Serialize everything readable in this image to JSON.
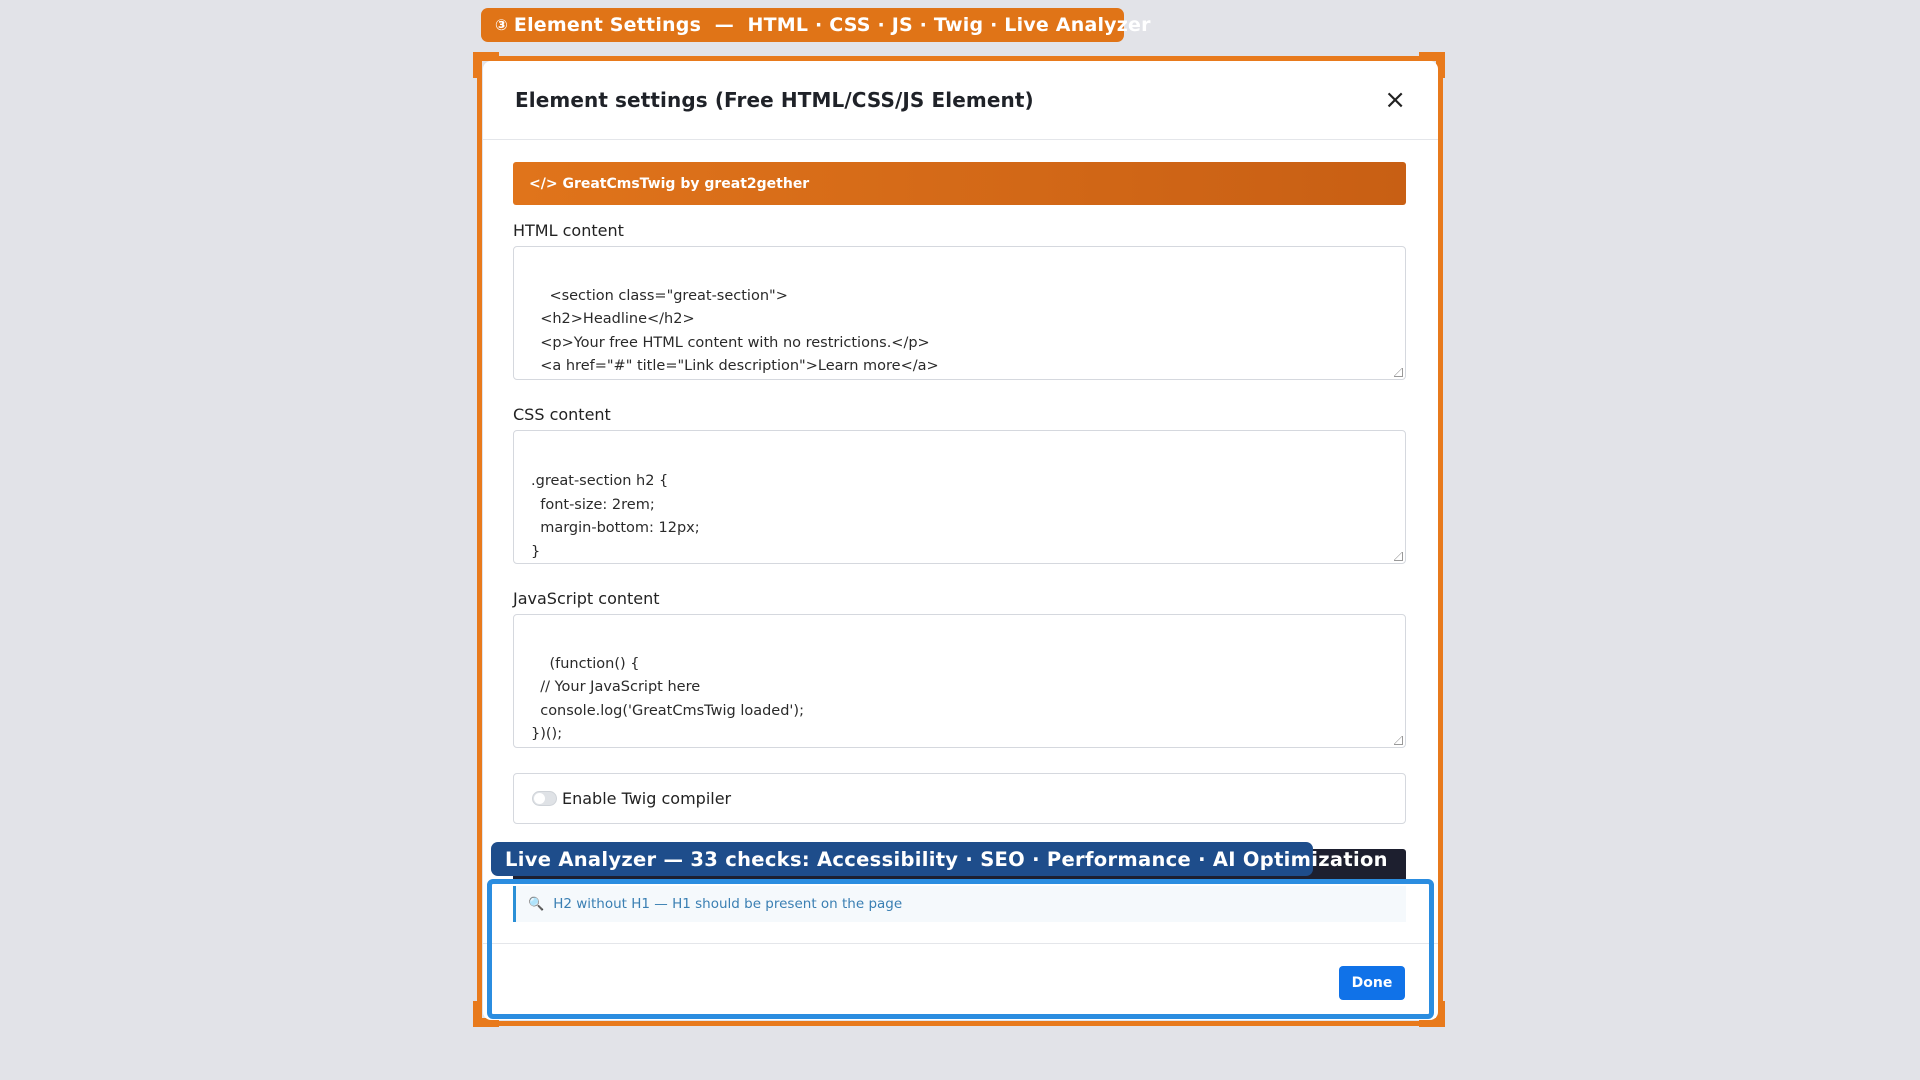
{
  "step_badge": {
    "number": "③",
    "text": "Element Settings  —  HTML · CSS · JS · Twig · Live Analyzer"
  },
  "modal": {
    "title": "Element settings (Free HTML/CSS/JS Element)",
    "close_icon": "×",
    "brand_bar": "</> GreatCmsTwig by great2gether",
    "html_label": "HTML content",
    "html_value": "<section class=\"great-section\">\n  <h2>Headline</h2>\n  <p>Your free HTML content with no restrictions.</p>\n  <a href=\"#\" title=\"Link description\">Learn more</a>\n</section>",
    "css_label": "CSS content",
    "css_value": ".great-section h2 {\n  font-size: 2rem;\n  margin-bottom: 12px;\n}\n.great-section a {\n  color: #fff;",
    "js_label": "JavaScript content",
    "js_value": "(function() {\n  // Your JavaScript here\n  console.log('GreatCmsTwig loaded');\n})();",
    "twig_label": "Enable Twig compiler",
    "twig_enabled": false,
    "issue_icon": "🔍",
    "issue_text": "H2 without H1 — H1 should be present on the page",
    "done_label": "Done"
  },
  "analyzer_label": "Live Analyzer — 33 checks: Accessibility · SEO · Performance · AI Optimization",
  "colors": {
    "accent_orange": "#e87a1c",
    "accent_blue": "#2b8de0",
    "primary_button": "#1072e8"
  }
}
